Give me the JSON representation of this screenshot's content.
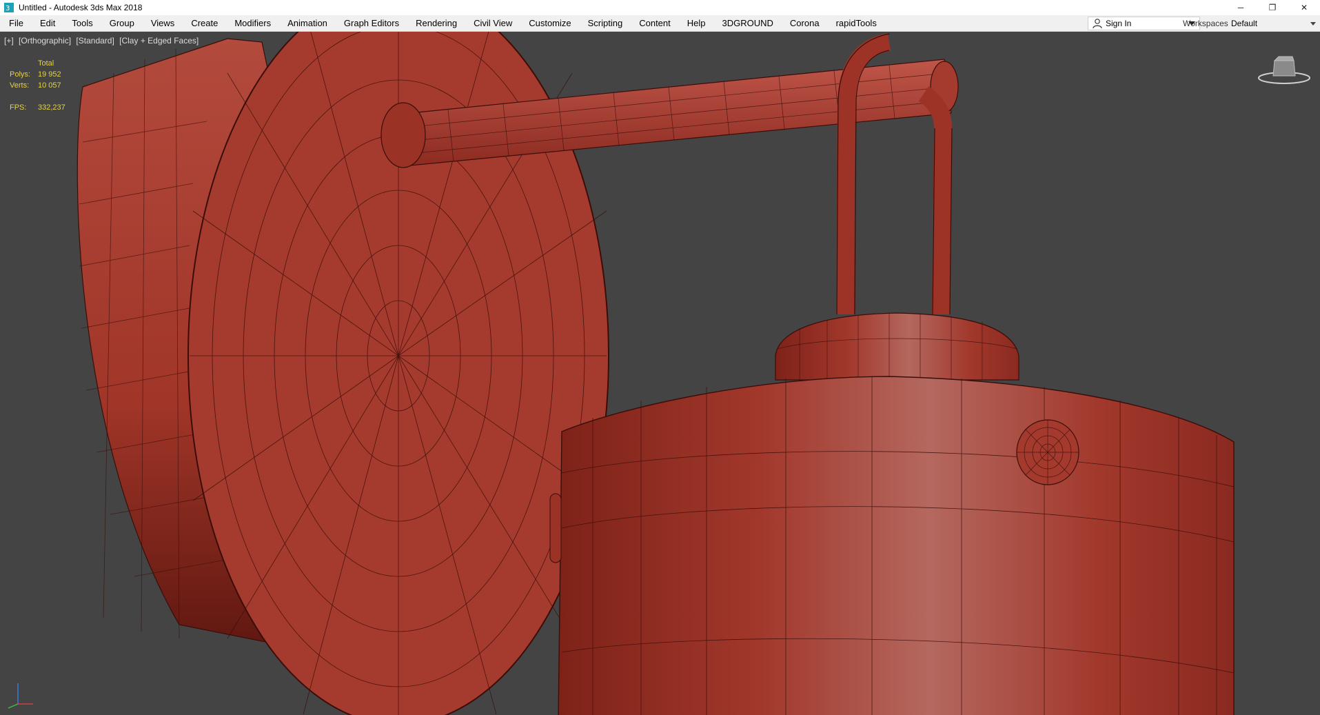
{
  "titlebar": {
    "title": "Untitled - Autodesk 3ds Max 2018",
    "minimize": "─",
    "restore": "❐",
    "close": "✕"
  },
  "menu": {
    "items": [
      "File",
      "Edit",
      "Tools",
      "Group",
      "Views",
      "Create",
      "Modifiers",
      "Animation",
      "Graph Editors",
      "Rendering",
      "Civil View",
      "Customize",
      "Scripting",
      "Content",
      "Help",
      "3DGROUND",
      "Corona",
      "rapidTools"
    ]
  },
  "account": {
    "sign_in": "Sign In",
    "workspaces_label": "Workspaces:",
    "workspace_value": "Default"
  },
  "viewport": {
    "labels": [
      "[+]",
      "[Orthographic]",
      "[Standard]",
      "[Clay + Edged Faces]"
    ],
    "stats": {
      "total_label": "Total",
      "polys_label": "Polys:",
      "polys_value": "19 952",
      "verts_label": "Verts:",
      "verts_value": "10 057",
      "fps_label": "FPS:",
      "fps_value": "332,237"
    }
  },
  "colors": {
    "viewport_bg": "#444444",
    "clay": "#a83a2f",
    "wire": "#3a0d08",
    "stats_text": "#e6d24a"
  }
}
